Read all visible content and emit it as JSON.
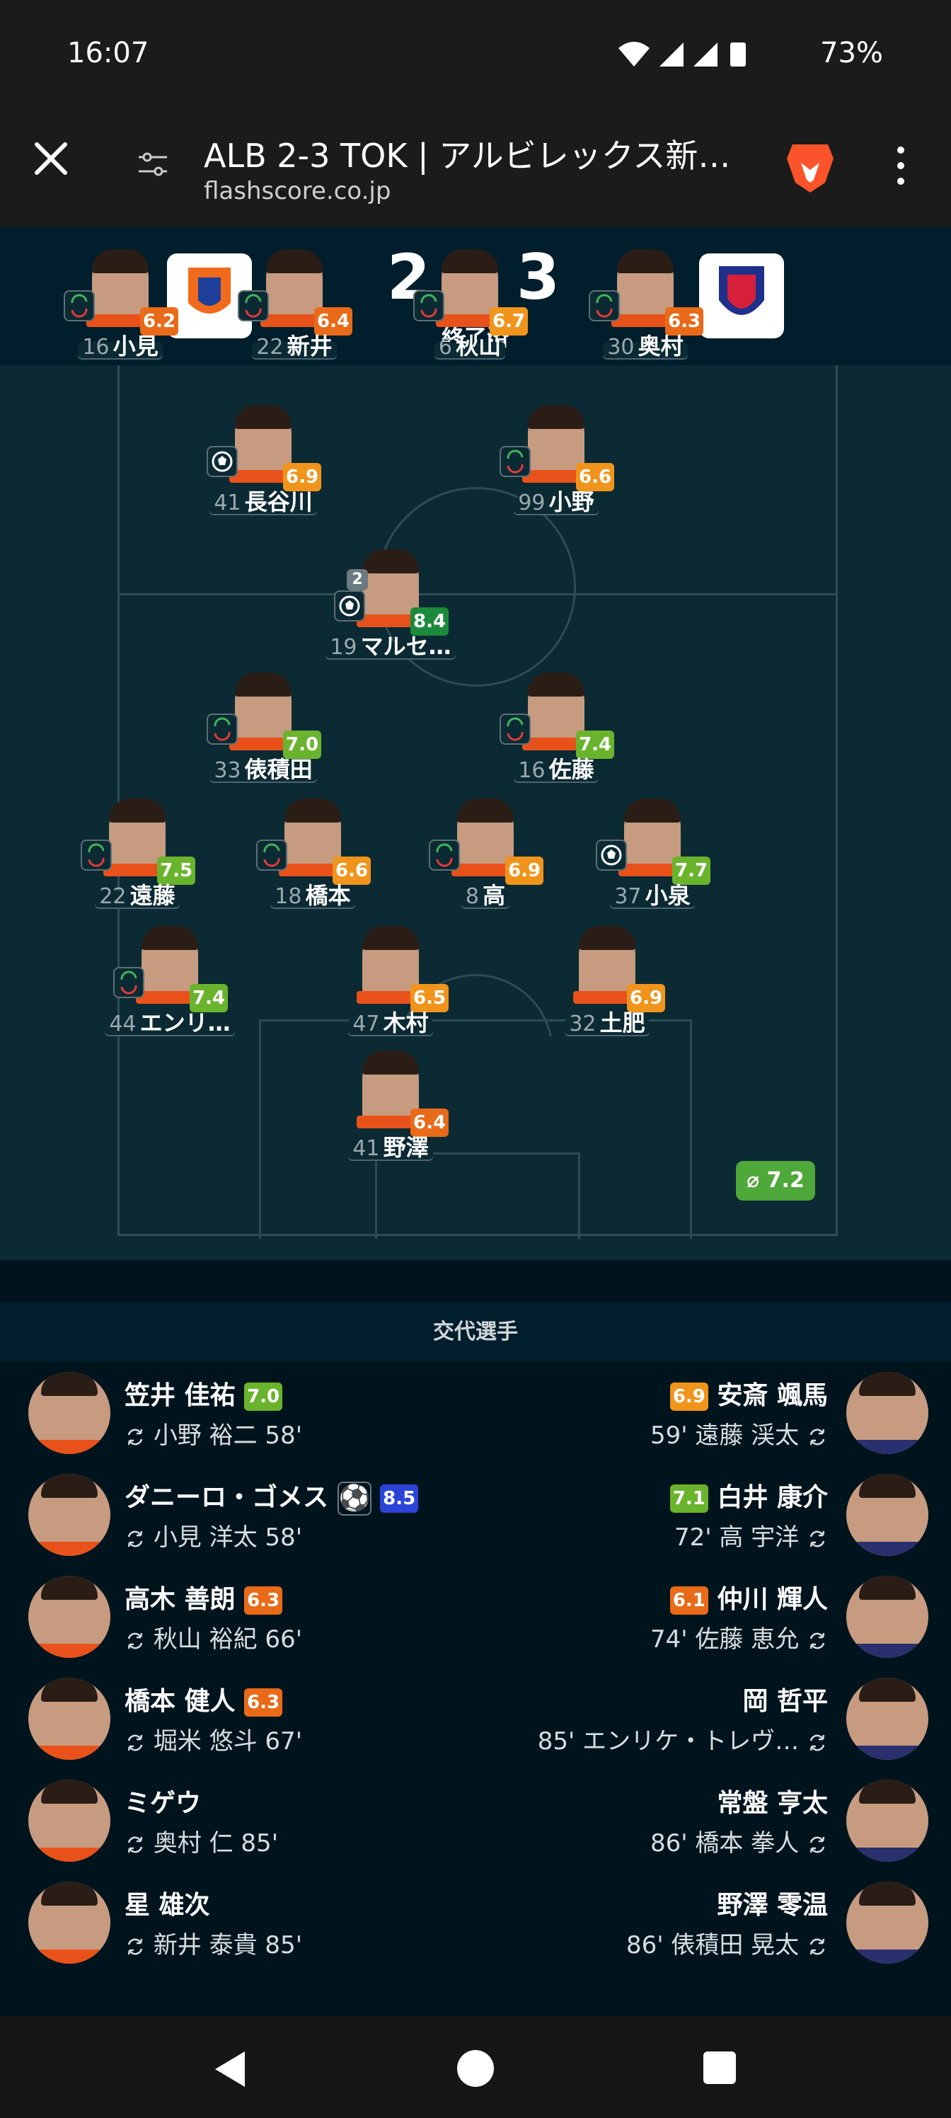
{
  "status_bar": {
    "time": "16:07",
    "battery": "73%"
  },
  "browser": {
    "title": "ALB 2-3 TOK | アルビレックス新…",
    "url": "flashscore.co.jp"
  },
  "match": {
    "score": "2 - 3",
    "status": "終了済"
  },
  "colors": {
    "rating_green_dark": "#1b8a3a",
    "rating_green": "#6ab42d",
    "rating_orange": "#f0941c",
    "rating_deep_orange": "#e96a18",
    "rating_blue": "#2a44d8"
  },
  "lineup": [
    {
      "no": "16",
      "name": "小見",
      "rating": "6.2",
      "event": "sub",
      "color": "#e96a18"
    },
    {
      "no": "22",
      "name": "新井",
      "rating": "6.4",
      "event": "sub",
      "color": "#e96a18"
    },
    {
      "no": "6",
      "name": "秋山",
      "rating": "6.7",
      "event": "sub",
      "color": "#f0941c"
    },
    {
      "no": "30",
      "name": "奥村",
      "rating": "6.3",
      "event": "sub",
      "color": "#e96a18"
    },
    {
      "no": "41",
      "name": "長谷川",
      "rating": "6.9",
      "event": "ball",
      "color": "#f0941c"
    },
    {
      "no": "99",
      "name": "小野",
      "rating": "6.6",
      "event": "sub",
      "color": "#f0941c"
    },
    {
      "no": "19",
      "name": "マルセ…",
      "rating": "8.4",
      "event": "ball",
      "goals": "2",
      "color": "#1b8a3a"
    },
    {
      "no": "33",
      "name": "俵積田",
      "rating": "7.0",
      "event": "sub",
      "color": "#6ab42d"
    },
    {
      "no": "16",
      "name": "佐藤",
      "rating": "7.4",
      "event": "sub",
      "color": "#6ab42d"
    },
    {
      "no": "22",
      "name": "遠藤",
      "rating": "7.5",
      "event": "sub",
      "color": "#6ab42d"
    },
    {
      "no": "18",
      "name": "橋本",
      "rating": "6.6",
      "event": "sub",
      "color": "#f0941c"
    },
    {
      "no": "8",
      "name": "高",
      "rating": "6.9",
      "event": "sub",
      "color": "#f0941c"
    },
    {
      "no": "37",
      "name": "小泉",
      "rating": "7.7",
      "event": "ball",
      "color": "#6ab42d"
    },
    {
      "no": "44",
      "name": "エンリ…",
      "rating": "7.4",
      "event": "sub",
      "color": "#6ab42d"
    },
    {
      "no": "47",
      "name": "木村",
      "rating": "6.5",
      "event": "",
      "color": "#f0941c"
    },
    {
      "no": "32",
      "name": "土肥",
      "rating": "6.9",
      "event": "",
      "color": "#f0941c"
    },
    {
      "no": "41",
      "name": "野澤",
      "rating": "6.4",
      "event": "",
      "color": "#e96a18"
    }
  ],
  "team_average": "⌀ 7.2",
  "subs_title": "交代選手",
  "subs": [
    {
      "home": {
        "name": "笠井 佳祐",
        "rating": "7.0",
        "color": "#6ab42d",
        "out": "小野 裕二 58'"
      },
      "away": {
        "name": "安斎 颯馬",
        "rating": "6.9",
        "color": "#f0941c",
        "out": "59' 遠藤 渓太"
      }
    },
    {
      "home": {
        "name": "ダニーロ・ゴメス",
        "rating": "8.5",
        "color": "#2a44d8",
        "out": "小見 洋太 58'"
      },
      "away": {
        "name": "白井 康介",
        "rating": "7.1",
        "color": "#6ab42d",
        "out": "72' 高 宇洋"
      }
    },
    {
      "home": {
        "name": "高木 善朗",
        "rating": "6.3",
        "color": "#e96a18",
        "out": "秋山 裕紀 66'"
      },
      "away": {
        "name": "仲川 輝人",
        "rating": "6.1",
        "color": "#e96a18",
        "out": "74' 佐藤 恵允"
      }
    },
    {
      "home": {
        "name": "橋本 健人",
        "rating": "6.3",
        "color": "#e96a18",
        "out": "堀米 悠斗 67'"
      },
      "away": {
        "name": "岡 哲平",
        "rating": "",
        "color": "",
        "out": "85' エンリケ・トレヴ…"
      }
    },
    {
      "home": {
        "name": "ミゲウ",
        "rating": "",
        "color": "",
        "out": "奥村 仁 85'"
      },
      "away": {
        "name": "常盤 亨太",
        "rating": "",
        "color": "",
        "out": "86' 橋本 拳人"
      }
    },
    {
      "home": {
        "name": "星 雄次",
        "rating": "",
        "color": "",
        "out": "新井 泰貴 85'"
      },
      "away": {
        "name": "野澤 零温",
        "rating": "",
        "color": "",
        "out": "86' 俵積田 晃太"
      }
    }
  ]
}
